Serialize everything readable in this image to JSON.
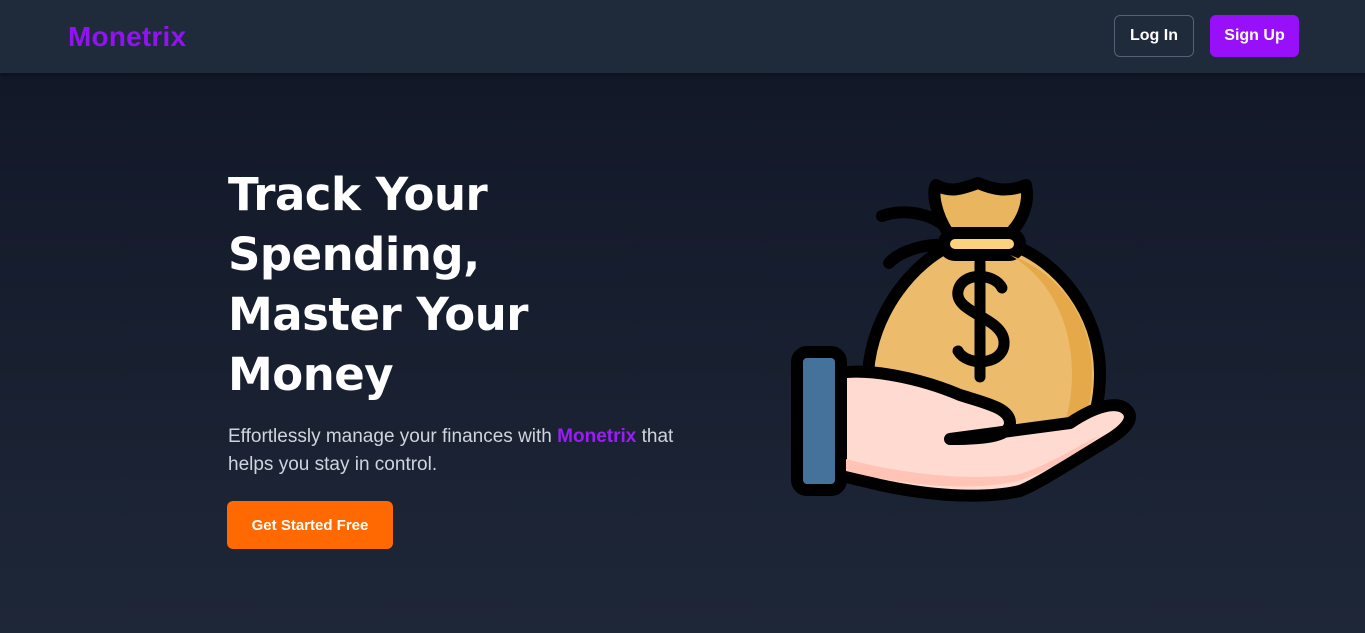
{
  "navbar": {
    "logo": "Monetrix",
    "login_label": "Log In",
    "signup_label": "Sign Up"
  },
  "hero": {
    "headline_lines": [
      "Track Your",
      "Spending,",
      "Master Your",
      "Money"
    ],
    "subtext_before": "Effortlessly manage your finances with ",
    "subtext_brand": "Monetrix",
    "subtext_after": " that helps you stay in control.",
    "cta_label": "Get Started Free",
    "illustration_icon": "money-bag-in-hand-icon"
  },
  "colors": {
    "brand": "#9810fa",
    "cta": "#ff6900",
    "background": "#161d2d",
    "navbar": "#1f2a3b"
  }
}
